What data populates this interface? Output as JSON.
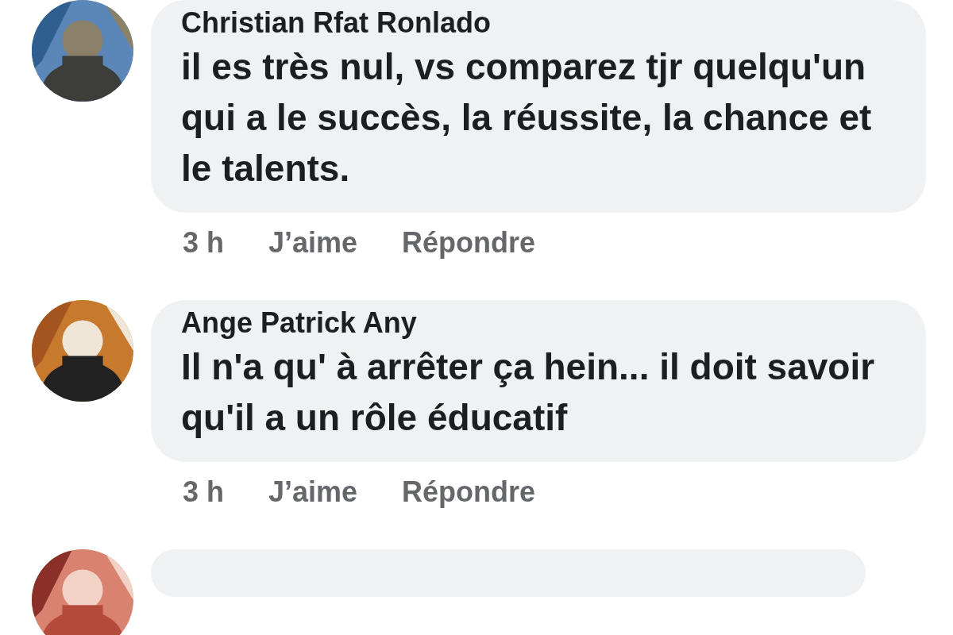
{
  "comments": [
    {
      "avatar": {
        "kind": "picture"
      },
      "author": "Christian Rfat Ronlado",
      "text": "il es très nul, vs comparez tjr quelqu'un qui a le succès, la réussite, la chance et le talents.",
      "time": "3 h",
      "actions": [
        "J’aime",
        "Répondre"
      ]
    },
    {
      "avatar": {
        "kind": "picture"
      },
      "author": "Ange Patrick Any",
      "text": "Il n'a qu' à arrêter ça hein... il doit savoir qu'il a un rôle éducatif",
      "time": "3 h",
      "actions": [
        "J’aime",
        "Répondre"
      ]
    },
    {
      "avatar": {
        "kind": "picture"
      }
    }
  ]
}
